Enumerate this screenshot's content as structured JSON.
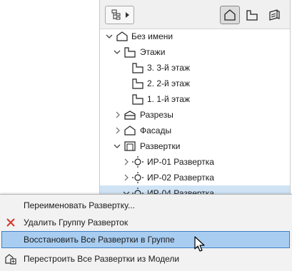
{
  "navigator": {
    "toolbar": {
      "map_popup_icon": "tree-menu-icon",
      "view_buttons": [
        {
          "name": "project-map",
          "icon": "project-map-icon",
          "active": true
        },
        {
          "name": "view-map",
          "icon": "view-map-icon",
          "active": false
        },
        {
          "name": "layout-book",
          "icon": "layout-book-icon",
          "active": false
        }
      ]
    },
    "tree": {
      "root": "Без имени",
      "stories_folder": "Этажи",
      "stories": [
        "3. 3-й этаж",
        "2. 2-й этаж",
        "1. 1-й этаж"
      ],
      "sections": "Разрезы",
      "elevations": "Фасады",
      "interior_elevations": "Развертки",
      "ie_items": [
        "ИР-01 Развертка",
        "ИР-02 Развертка",
        "ИР-04 Развертка"
      ]
    }
  },
  "context_menu": {
    "items": [
      {
        "label": "Переименовать Развертку...",
        "icon": ""
      },
      {
        "label": "Удалить Группу Разверток",
        "icon": "delete-x-icon"
      },
      {
        "label": "Восстановить Все Развертки в Группе",
        "icon": "",
        "selected": true
      },
      {
        "label": "Перестроить Все Развертки из Модели",
        "icon": "rebuild-icon"
      }
    ]
  },
  "colors": {
    "selection": "#a9cdf0",
    "selection_border": "#3c7fc7",
    "tree_highlight": "#cfe3f5",
    "delete_icon": "#d9362b"
  }
}
